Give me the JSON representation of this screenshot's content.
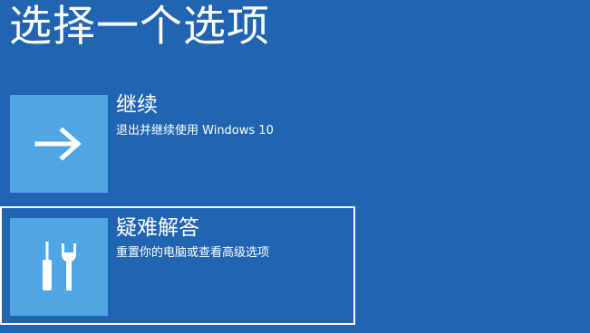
{
  "screen": {
    "title": "选择一个选项",
    "background_color": "#2064b2",
    "tile_color": "#4fa6e3"
  },
  "options": [
    {
      "title": "继续",
      "description": "退出并继续使用 Windows 10",
      "icon": "arrow-right-icon",
      "selected": false
    },
    {
      "title": "疑难解答",
      "description": "重置你的电脑或查看高级选项",
      "icon": "tools-icon",
      "selected": true
    }
  ]
}
